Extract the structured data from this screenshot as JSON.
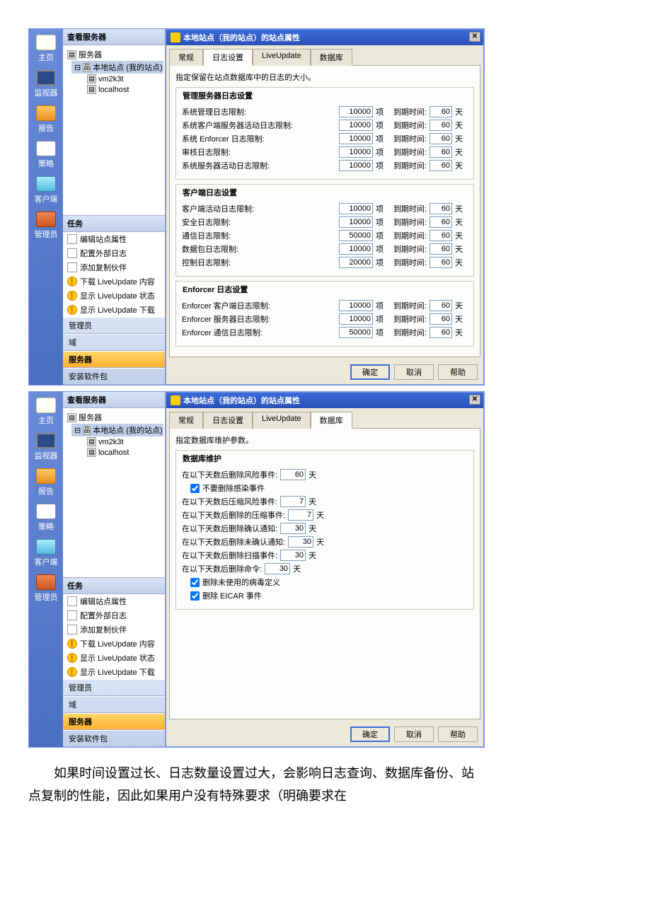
{
  "nav": [
    {
      "k": "home",
      "l": "主页"
    },
    {
      "k": "monitor",
      "l": "监视器"
    },
    {
      "k": "report",
      "l": "报告"
    },
    {
      "k": "policy",
      "l": "策略"
    },
    {
      "k": "client",
      "l": "客户端"
    },
    {
      "k": "admin",
      "l": "管理员"
    }
  ],
  "tree": {
    "header": "查看服务器",
    "root": "服务器",
    "site": "本地站点 (我的站点)",
    "children": [
      "vm2k3t",
      "localhost"
    ]
  },
  "tasks": {
    "header": "任务",
    "items": [
      {
        "k": "edit",
        "l": "编辑站点属性"
      },
      {
        "k": "ext",
        "l": "配置外部日志"
      },
      {
        "k": "rep",
        "l": "添加复制伙伴"
      },
      {
        "k": "dl",
        "l": "下载 LiveUpdate 内容"
      },
      {
        "k": "st",
        "l": "显示 LiveUpdate 状态"
      },
      {
        "k": "sd",
        "l": "显示 LiveUpdate 下载"
      }
    ]
  },
  "bottombar": [
    {
      "k": "admin",
      "l": "管理员"
    },
    {
      "k": "domain",
      "l": "域"
    },
    {
      "k": "server",
      "l": "服务器"
    },
    {
      "k": "pkg",
      "l": "安装软件包"
    }
  ],
  "dlg": {
    "title": "本地站点（我的站点）的站点属性",
    "tabs": [
      "常规",
      "日志设置",
      "LiveUpdate",
      "数据库"
    ],
    "log": {
      "hint": "指定保留在站点数据库中的日志的大小。",
      "g1": "管理服务器日志设置",
      "g1rows": [
        {
          "l": "系统管理日志限制:",
          "v": "10000",
          "u": "项",
          "e": "到期时间:",
          "ev": "60",
          "eu": "天"
        },
        {
          "l": "系统客户端服务器活动日志限制:",
          "v": "10000",
          "u": "项",
          "e": "到期时间:",
          "ev": "60",
          "eu": "天"
        },
        {
          "l": "系统 Enforcer 日志限制:",
          "v": "10000",
          "u": "项",
          "e": "到期时间:",
          "ev": "60",
          "eu": "天"
        },
        {
          "l": "审核日志限制:",
          "v": "10000",
          "u": "项",
          "e": "到期时间:",
          "ev": "60",
          "eu": "天"
        },
        {
          "l": "系统服务器活动日志限制:",
          "v": "10000",
          "u": "项",
          "e": "到期时间:",
          "ev": "60",
          "eu": "天"
        }
      ],
      "g2": "客户端日志设置",
      "g2rows": [
        {
          "l": "客户端活动日志限制:",
          "v": "10000",
          "u": "项",
          "e": "到期时间:",
          "ev": "60",
          "eu": "天"
        },
        {
          "l": "安全日志限制:",
          "v": "10000",
          "u": "项",
          "e": "到期时间:",
          "ev": "60",
          "eu": "天"
        },
        {
          "l": "通信日志限制:",
          "v": "50000",
          "u": "项",
          "e": "到期时间:",
          "ev": "60",
          "eu": "天"
        },
        {
          "l": "数据包日志限制:",
          "v": "10000",
          "u": "项",
          "e": "到期时间:",
          "ev": "60",
          "eu": "天"
        },
        {
          "l": "控制日志限制:",
          "v": "20000",
          "u": "项",
          "e": "到期时间:",
          "ev": "60",
          "eu": "天"
        }
      ],
      "g3": "Enforcer 日志设置",
      "g3rows": [
        {
          "l": "Enforcer 客户端日志限制:",
          "v": "10000",
          "u": "项",
          "e": "到期时间:",
          "ev": "60",
          "eu": "天"
        },
        {
          "l": "Enforcer 服务器日志限制:",
          "v": "10000",
          "u": "项",
          "e": "到期时间:",
          "ev": "60",
          "eu": "天"
        },
        {
          "l": "Enforcer 通信日志限制:",
          "v": "50000",
          "u": "项",
          "e": "到期时间:",
          "ev": "60",
          "eu": "天"
        }
      ]
    },
    "db": {
      "hint": "指定数据库维护参数。",
      "g": "数据库维护",
      "rows": [
        {
          "l": "在以下天数后删除风险事件:",
          "v": "60",
          "u": "天"
        },
        {
          "chk": true,
          "l": "不要删除感染事件"
        },
        {
          "l": "在以下天数后压缩风险事件:",
          "v": "7",
          "u": "天"
        },
        {
          "l": "在以下天数后删除的压缩事件:",
          "v": "7",
          "u": "天"
        },
        {
          "l": "在以下天数后删除确认通知:",
          "v": "30",
          "u": "天"
        },
        {
          "l": "在以下天数后删除未确认通知:",
          "v": "30",
          "u": "天"
        },
        {
          "l": "在以下天数后删除扫描事件:",
          "v": "30",
          "u": "天"
        },
        {
          "l": "在以下天数后删除命令:",
          "v": "30",
          "u": "天"
        },
        {
          "chk": true,
          "l": "删除未使用的病毒定义"
        },
        {
          "chk": true,
          "l": "删除 EICAR 事件"
        }
      ]
    },
    "btns": {
      "ok": "确定",
      "cancel": "取消",
      "help": "帮助"
    }
  },
  "footer": "如果时间设置过长、日志数量设置过大，会影响日志查询、数据库备份、站点复制的性能，因此如果用户没有特殊要求（明确要求在"
}
